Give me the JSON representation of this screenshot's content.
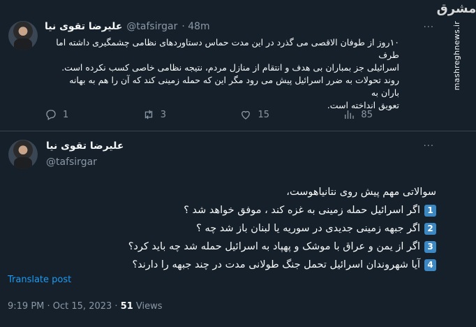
{
  "tweet1": {
    "display_name": "علیرضا تقوی نیا",
    "handle": "@tafsirgar",
    "time": "· 48m",
    "text_lines": [
      "۱۰روز از طوفان الاقصی می گذرد در این مدت حماس دستاوردهای نظامی چشمگیری داشته اما طرف",
      "اسرائیلی جز بمباران بی هدف و انتقام از منازل مردم، نتیجه نظامی خاصی کسب نکرده است.",
      "روند تحولات به ضرر اسرائیل پیش می رود مگر این که حمله زمینی کند که آن را هم به بهانه باران به",
      "تعویق انداخته است."
    ],
    "actions": {
      "replies": "1",
      "retweets": "3",
      "likes": "15",
      "views": "85"
    }
  },
  "tweet2": {
    "display_name": "علیرضا تقوی نیا",
    "handle": "@tafsirgar",
    "intro": "سوالاتی مهم پیش روی نتانیاهوست،",
    "questions": [
      {
        "num": "1",
        "text": "اگر اسرائیل حمله زمینی به غزه کند ، موفق خواهد شد ؟"
      },
      {
        "num": "2",
        "text": "اگر جبهه زمینی جدیدی در سوریه یا لبنان باز شد چه ؟"
      },
      {
        "num": "3",
        "text": "اگر از یمن و عراق با موشک و پهپاد به اسرائیل حمله شد چه باید کرد؟"
      },
      {
        "num": "4",
        "text": "آیا شهروندان اسرائیل تحمل جنگ طولانی مدت در چند جبهه را دارند؟"
      }
    ],
    "translate_label": "Translate post",
    "timestamp": "9:19 PM · Oct 15, 2023 · ",
    "views_count": "51",
    "views_label": " Views"
  },
  "watermark": {
    "logo": "مشرق",
    "url": "mashreghnews.ir"
  },
  "more_label": "···",
  "colors": {
    "background": "#15202b",
    "text": "#f7f9f9",
    "secondary": "#8b98a5",
    "link": "#1d9bf0",
    "keycap": "#3b88c3"
  }
}
